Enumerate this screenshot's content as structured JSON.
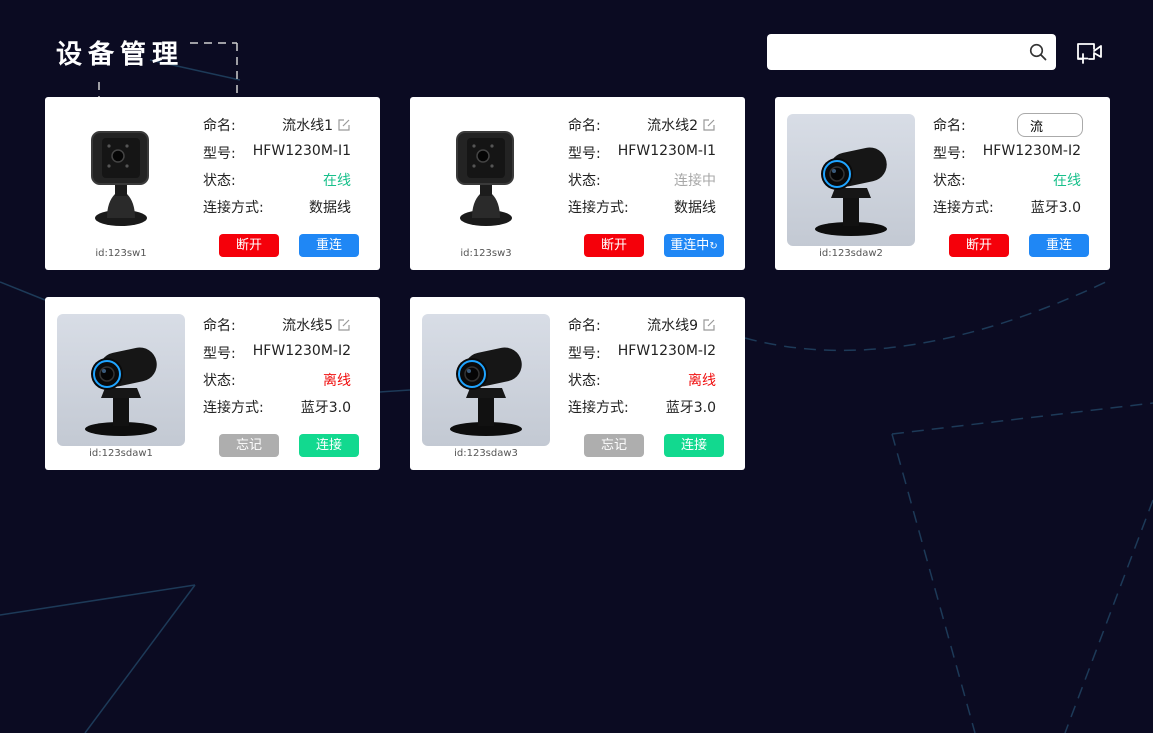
{
  "page": {
    "title": "设备管理"
  },
  "search": {
    "value": "",
    "placeholder": ""
  },
  "icons": {
    "search": "search-icon",
    "add_device": "add-camera-icon",
    "edit": "edit-icon"
  },
  "colors": {
    "background": "#0b0b22",
    "online": "#18c08b",
    "offline": "#f01010",
    "connecting": "#a8a8a8",
    "btn_red": "#f5000a",
    "btn_blue": "#1f87f5",
    "btn_gray": "#aeaeae",
    "btn_green": "#12d98f"
  },
  "labels": {
    "name": "命名:",
    "model": "型号:",
    "status": "状态:",
    "connection": "连接方式:"
  },
  "devices": [
    {
      "id_text": "id:123sw1",
      "name": "流水线1",
      "model": "HFW1230M-I1",
      "status": "在线",
      "connection": "数据线",
      "btn_left": "断开",
      "btn_right": "重连",
      "image": "cube-camera"
    },
    {
      "id_text": "id:123sw3",
      "name": "流水线2",
      "model": "HFW1230M-I1",
      "status": "连接中",
      "connection": "数据线",
      "btn_left": "断开",
      "btn_right": "重连中",
      "image": "cube-camera"
    },
    {
      "id_text": "id:123sdaw2",
      "name": "流",
      "model": "HFW1230M-I2",
      "status": "在线",
      "connection": "蓝牙3.0",
      "btn_left": "断开",
      "btn_right": "重连",
      "image": "webcam",
      "name_editing": true
    },
    {
      "id_text": "id:123sdaw1",
      "name": "流水线5",
      "model": "HFW1230M-I2",
      "status": "离线",
      "connection": "蓝牙3.0",
      "btn_left": "忘记",
      "btn_right": "连接",
      "image": "webcam"
    },
    {
      "id_text": "id:123sdaw3",
      "name": "流水线9",
      "model": "HFW1230M-I2",
      "status": "离线",
      "connection": "蓝牙3.0",
      "btn_left": "忘记",
      "btn_right": "连接",
      "image": "webcam"
    }
  ]
}
